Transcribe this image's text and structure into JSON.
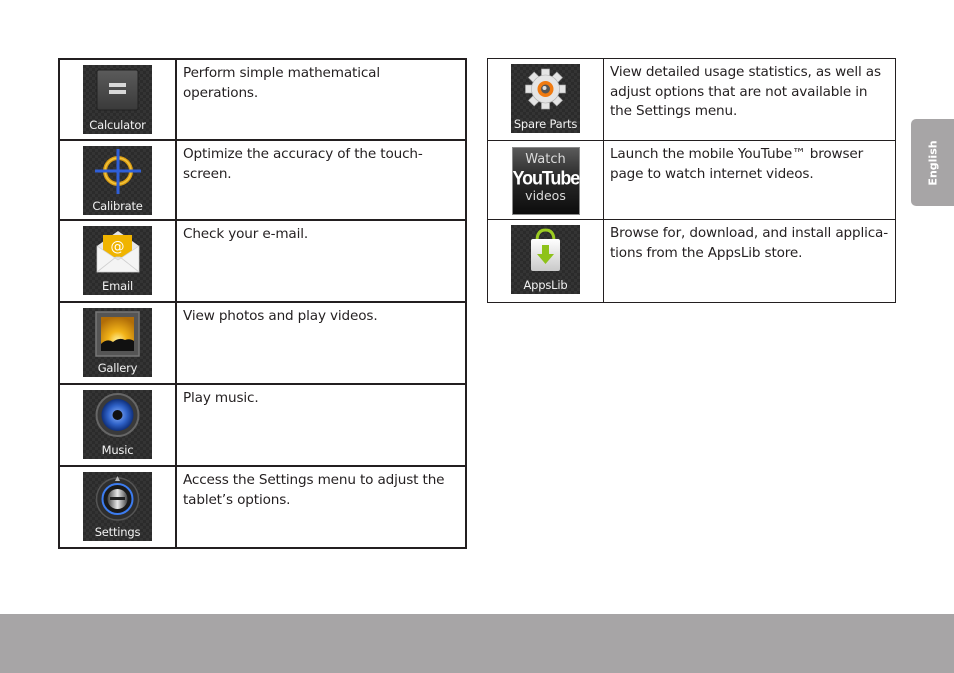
{
  "left_table": {
    "rows": [
      {
        "icon": "calculator-icon",
        "label": "Calculator",
        "description": "Perform simple mathematical operations."
      },
      {
        "icon": "calibrate-icon",
        "label": "Calibrate",
        "description": "Optimize the accuracy of the touch-screen."
      },
      {
        "icon": "email-icon",
        "label": "Email",
        "description": "Check your e-mail."
      },
      {
        "icon": "gallery-icon",
        "label": "Gallery",
        "description": "View photos and play videos."
      },
      {
        "icon": "music-icon",
        "label": "Music",
        "description": "Play music."
      },
      {
        "icon": "settings-icon",
        "label": "Settings",
        "description": "Access the Settings menu to adjust the tablet’s options."
      }
    ]
  },
  "right_table": {
    "rows": [
      {
        "icon": "spare-parts-icon",
        "label": "Spare Parts",
        "description": "View detailed usage statistics, as well as adjust options that are not available in the Settings menu."
      },
      {
        "icon": "youtube-icon",
        "label_top": "Watch",
        "label_brand": "YouTube",
        "label_bottom": "videos",
        "description": "Launch the mobile YouTube™ browser page to watch internet videos."
      },
      {
        "icon": "appslib-icon",
        "label": "AppsLib",
        "description": "Browse for, download, and install applica-tions from the AppsLib store."
      }
    ]
  },
  "side_tab": {
    "label": "English"
  },
  "colors": {
    "band": "#a7a5a6",
    "icon_bg": "#2b2b2b",
    "text": "#231f20"
  }
}
